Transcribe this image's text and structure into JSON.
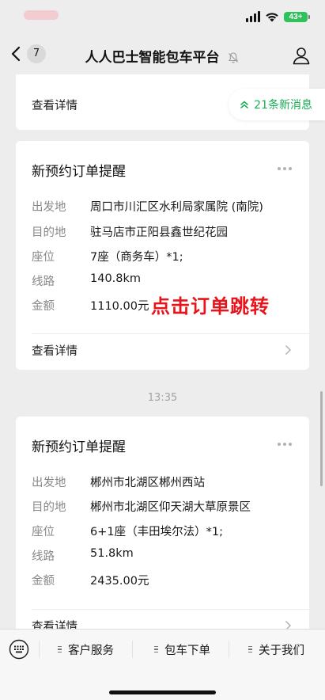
{
  "status_bar": {
    "battery": "43+"
  },
  "nav": {
    "back_count": "7",
    "title": "人人巴士智能包车平台"
  },
  "new_messages": {
    "label": "21条新消息"
  },
  "partial_card": {
    "detail_label": "查看详情"
  },
  "cards": [
    {
      "title": "新预约订单提醒",
      "fields": [
        {
          "key": "出发地",
          "value": "周口市川汇区水利局家属院 (南院)"
        },
        {
          "key": "目的地",
          "value": "驻马店市正阳县鑫世纪花园"
        },
        {
          "key": "座位",
          "value": "7座（商务车）*1;"
        },
        {
          "key": "线路",
          "value": "140.8km"
        },
        {
          "key": "金额",
          "value": "1110.00元"
        }
      ],
      "detail_label": "查看详情"
    },
    {
      "title": "新预约订单提醒",
      "fields": [
        {
          "key": "出发地",
          "value": "郴州市北湖区郴州西站"
        },
        {
          "key": "目的地",
          "value": "郴州市北湖区仰天湖大草原景区"
        },
        {
          "key": "座位",
          "value": "6+1座（丰田埃尔法）*1;"
        },
        {
          "key": "线路",
          "value": "51.8km"
        },
        {
          "key": "金额",
          "value": "2435.00元"
        }
      ],
      "detail_label": "查看详情"
    }
  ],
  "time_separator": "13:35",
  "annotation": "点击订单跳转",
  "bottom_menu": {
    "items": [
      {
        "label": "客户服务"
      },
      {
        "label": "包车下单"
      },
      {
        "label": "关于我们"
      }
    ]
  },
  "colors": {
    "accent_green": "#1aad55",
    "annotation_red": "#e8141b",
    "battery_green": "#2fc25b"
  }
}
